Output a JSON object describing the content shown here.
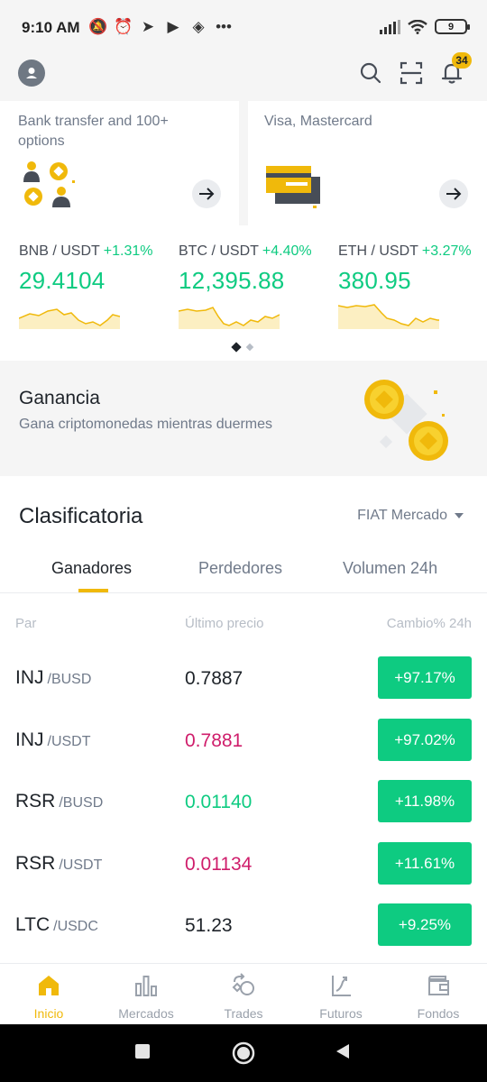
{
  "status": {
    "time": "9:10 AM",
    "icons": [
      "mute-icon",
      "alarm-icon",
      "telegram-icon",
      "youtube-icon",
      "binance-icon",
      "more-icon"
    ],
    "battery": "9"
  },
  "header": {
    "notification_count": "34"
  },
  "cards": [
    {
      "desc": "Bank transfer and 100+ options"
    },
    {
      "desc": "Visa, Mastercard"
    }
  ],
  "tickers": [
    {
      "pair": "BNB / USDT",
      "change": "+1.31%",
      "price": "29.4104"
    },
    {
      "pair": "BTC / USDT",
      "change": "+4.40%",
      "price": "12,395.88"
    },
    {
      "pair": "ETH / USDT",
      "change": "+3.27%",
      "price": "380.95"
    }
  ],
  "earn": {
    "title": "Ganancia",
    "subtitle": "Gana criptomonedas mientras duermes"
  },
  "ranking": {
    "title": "Clasificatoria",
    "filter": "FIAT Mercado",
    "tabs": [
      "Ganadores",
      "Perdedores",
      "Volumen 24h"
    ],
    "columns": [
      "Par",
      "Último precio",
      "Cambio% 24h"
    ],
    "rows": [
      {
        "base": "INJ",
        "quote": "/BUSD",
        "price": "0.7887",
        "price_color": "#1e2329",
        "change": "+97.17%"
      },
      {
        "base": "INJ",
        "quote": "/USDT",
        "price": "0.7881",
        "price_color": "#cf1d6b",
        "change": "+97.02%"
      },
      {
        "base": "RSR",
        "quote": "/BUSD",
        "price": "0.01140",
        "price_color": "#0ecb81",
        "change": "+11.98%"
      },
      {
        "base": "RSR",
        "quote": "/USDT",
        "price": "0.01134",
        "price_color": "#cf1d6b",
        "change": "+11.61%"
      },
      {
        "base": "LTC",
        "quote": "/USDC",
        "price": "51.23",
        "price_color": "#1e2329",
        "change": "+9.25%"
      }
    ]
  },
  "bottom_nav": [
    {
      "label": "Inicio",
      "icon": "home-icon",
      "active": true
    },
    {
      "label": "Mercados",
      "icon": "markets-icon",
      "active": false
    },
    {
      "label": "Trades",
      "icon": "trades-icon",
      "active": false
    },
    {
      "label": "Futuros",
      "icon": "futures-icon",
      "active": false
    },
    {
      "label": "Fondos",
      "icon": "wallet-icon",
      "active": false
    }
  ],
  "colors": {
    "accent": "#f0b90b",
    "up": "#0ecb81",
    "down": "#cf1d6b"
  }
}
